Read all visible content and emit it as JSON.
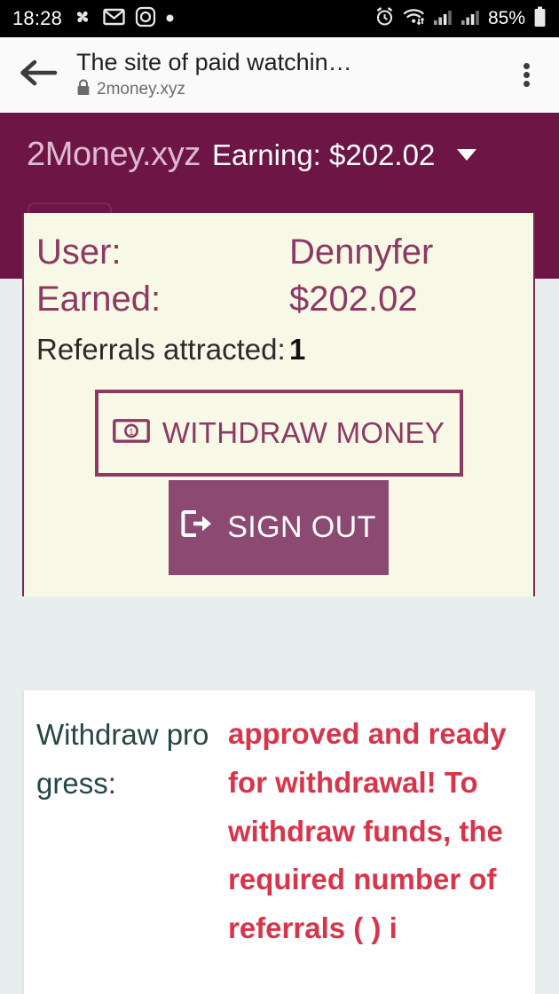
{
  "statusbar": {
    "clock": "18:28",
    "battery_pct": "85%",
    "left_icons": [
      "pinwheel-icon",
      "mail-icon",
      "instagram-icon",
      "dot-icon"
    ],
    "right_icons": [
      "alarm-icon",
      "wifi-icon",
      "signal-icon",
      "signal-icon",
      "battery-icon"
    ]
  },
  "browser": {
    "page_title": "The site of paid watchin…",
    "url": "2money.xyz",
    "back_icon": "back-arrow-icon",
    "lock_icon": "lock-icon",
    "menu_icon": "overflow-menu-icon"
  },
  "banner": {
    "brand": "2Money.xyz",
    "earning": "Earning: $202.02",
    "caret_icon": "chevron-down-icon",
    "bg_color": "#6d1646",
    "brand_color": "#dfb9cd"
  },
  "card": {
    "user_label": "User:",
    "user_value": "Dennyfer",
    "earned_label": "Earned:",
    "earned_value": "$202.02",
    "referrals_label": "Referrals attracted:",
    "referrals_value": "1",
    "withdraw_button": "WITHDRAW MONEY",
    "withdraw_icon": "banknote-icon",
    "signout_button": "SIGN OUT",
    "signout_icon": "sign-out-icon",
    "bg_color": "#f8f8e6",
    "accent_color": "#8c3964"
  },
  "progress": {
    "label": "Withdraw progress:",
    "value": "approved and ready for withdrawal! To withdraw funds, the required number of referrals (                ) i",
    "label_color": "#254743",
    "value_color": "#d8344a"
  }
}
